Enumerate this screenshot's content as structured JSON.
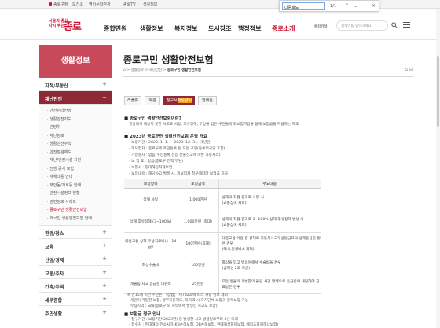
{
  "topbar": {
    "links": [
      "종로구청",
      "보건소",
      "역사문화관광",
      "종로TV",
      "생활정보"
    ]
  },
  "findbar": {
    "query": "다중호도",
    "count": "1/1"
  },
  "logo": {
    "small_line1": "서울의 중심",
    "small_line2": "다시 뛰는",
    "big": "종로"
  },
  "gnb": [
    "종합민원",
    "생활정보",
    "복지정보",
    "도시창조",
    "행정정보",
    "종로소개"
  ],
  "search": {
    "select_label": "통합검색",
    "placeholder": "검색어를 입력하세요"
  },
  "sidebar": {
    "title": "생활정보",
    "items": [
      {
        "label": "지적/부동산",
        "icon": "+"
      },
      {
        "label": "재난안전",
        "icon": "−",
        "open": true
      },
      {
        "label": "환경/청소",
        "icon": "+"
      },
      {
        "label": "교육",
        "icon": "+"
      },
      {
        "label": "산업/경제",
        "icon": "+"
      },
      {
        "label": "교통/주차",
        "icon": "+"
      },
      {
        "label": "건축/주택",
        "icon": "+"
      },
      {
        "label": "세무종합",
        "icon": "+"
      },
      {
        "label": "주민생활",
        "icon": "+"
      }
    ],
    "sub_items": [
      "안전관리헌장",
      "생활안전지도",
      "민방위",
      "재난정보",
      "생활안전수칙",
      "안전점검제도",
      "재난/안전시설 지원",
      "전쟁 공사 보험",
      "재해대응 안내",
      "부안동/가로등 안내",
      "안전시설정보 현황",
      "관련정보 사이트",
      "종로구민 생활안전보험",
      "외국인 생활안전보험 안내"
    ],
    "sub_active_index": 12
  },
  "page": {
    "title": "종로구민 생활안전보험",
    "breadcrumb": [
      "생활정보",
      "재난안전",
      "종로구민 생활안전보험"
    ],
    "tools": "⌂  ⊟"
  },
  "tabs": [
    {
      "label": "리플릿"
    },
    {
      "label": "약관"
    },
    {
      "label": "청구서 작성 양식",
      "active": true,
      "pre": "청구서",
      "hl": "작성양식"
    },
    {
      "label": "안내문"
    }
  ],
  "content": {
    "sec1_title": "■ 종로구민 생활안전보험이란?",
    "sec1_text": "일상에서 예상치 못한 사고로 사망, 후유장해, 부상을 입은 구민들에게 보험가입을 통해 보험금을 지급하는 제도",
    "sec2_title": "■ 2023년 종로구민 생활안전보험 운영 개요",
    "sec2_lines": [
      "- 보장기간 : 2023. 1. 1. ~ 2023. 12. 31. (1년간)",
      "- 피보험자 : 종로구에 주민등록 된 모든 구민(등록외국인 포함)",
      "- 가입절차 : 없음(주민등록 전입 전출신고에 따른 자동처리)",
      "- 보 험 료 : 없음(종로구 전액 부담)",
      "- 보험사 : 현대해상화재보험",
      "- 보장내용 : 해당사고 발생 시, 피보험자 청구에따라 보험금 지급"
    ],
    "table": {
      "headers": [
        "보장항목",
        "보장금액",
        "주요내용"
      ],
      "rows": [
        {
          "item": "상해 사망",
          "amount": "1,000만원",
          "desc": [
            "상해의 직접 결과로 사망 시",
            "(교통상해 제외)"
          ]
        },
        {
          "item": "상해 후유장해 (3~100%)",
          "amount": "1,000만원 (최대)",
          "desc": [
            "상해의 직접 결과로 3~100% 상해 후유장해 발생 시",
            "(교통상해 제외)"
          ]
        },
        {
          "item": "대중교통 상해 부상치료비(1~14급)",
          "amount": "100만원 (최대)",
          "desc": [
            "대중교통 이용 중 상해로 자동차사고부상등급표의 상해등급을 받은 경우",
            "(택시,전세버스 제외)"
          ]
        },
        {
          "item": "화상수술비",
          "amount": "100만원",
          "desc": [
            "화상을 입고 병의원에서 수술받을 경우",
            "(심재성 2도 이상)"
          ]
        },
        {
          "item": "개물림 사고 응급실 내원비",
          "amount": "25만원",
          "desc": [
            "모든 동물의 개방한의 물림 사건 발생으로 응급실에 내원하여 진료받은 경우"
          ]
        }
      ]
    },
    "notes": [
      "※ 만15세 미만 주민은 「상법」 제732조에 따라 사망 담보 제외",
      "개인이 가입한 보험, 정부지원제도, 타지역 시 자치단체 보험과 중복보장 가능",
      "부장지역 : 국내(종로구 외 지역에서 발생한 사고도 보장)"
    ],
    "sec3_title": "■ 보험금 청구 안내",
    "sec3_lines": [
      "- 청구기간 : 보장기간(2023년) 중 발생한 사고 발생일로부터 3년 이내",
      "- 접수처 : 현대해상 전소시가(KB손해보험, DB손해보험, 현대해상화재보험, 메리츠화재해상보험)"
    ]
  }
}
